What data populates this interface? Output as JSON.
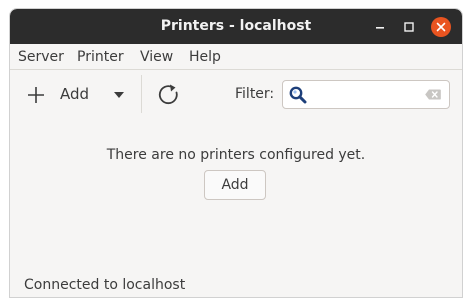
{
  "window": {
    "title": "Printers - localhost",
    "controls": {
      "minimize": "minimize-icon",
      "maximize": "maximize-icon",
      "close": "close-icon"
    },
    "accent_color": "#e95420"
  },
  "menubar": {
    "items": [
      {
        "label": "Server"
      },
      {
        "label": "Printer"
      },
      {
        "label": "View"
      },
      {
        "label": "Help"
      }
    ]
  },
  "toolbar": {
    "add_label": "Add",
    "add_icon": "plus-icon",
    "add_dropdown_icon": "triangle-down-icon",
    "refresh_icon": "refresh-icon",
    "filter_label": "Filter:",
    "filter_value": "",
    "filter_search_icon": "search-icon",
    "filter_clear_icon": "clear-icon"
  },
  "main": {
    "empty_message": "There are no printers configured yet.",
    "add_button_label": "Add"
  },
  "statusbar": {
    "text": "Connected to localhost"
  }
}
